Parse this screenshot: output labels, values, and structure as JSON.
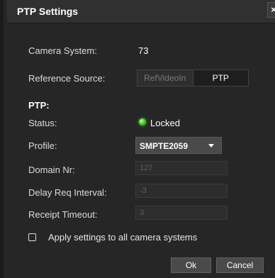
{
  "dialog": {
    "title": "PTP Settings",
    "close_glyph": "×"
  },
  "camera_system": {
    "label": "Camera System:",
    "value": "73"
  },
  "reference_source": {
    "label": "Reference Source:",
    "options": [
      "RefVideoIn",
      "PTP"
    ],
    "selected": "PTP"
  },
  "ptp": {
    "heading": "PTP:",
    "status": {
      "label": "Status:",
      "value": "Locked",
      "indicator_color": "#4cd22c"
    },
    "profile": {
      "label": "Profile:",
      "value": "SMPTE2059"
    },
    "domain_nr": {
      "label": "Domain Nr:",
      "value": "127"
    },
    "delay_req_interval": {
      "label": "Delay Req Interval:",
      "value": "-3"
    },
    "receipt_timeout": {
      "label": "Receipt Timeout:",
      "value": "3"
    }
  },
  "apply_all": {
    "label": "Apply settings to all camera systems",
    "checked": false
  },
  "buttons": {
    "ok": "Ok",
    "cancel": "Cancel"
  }
}
